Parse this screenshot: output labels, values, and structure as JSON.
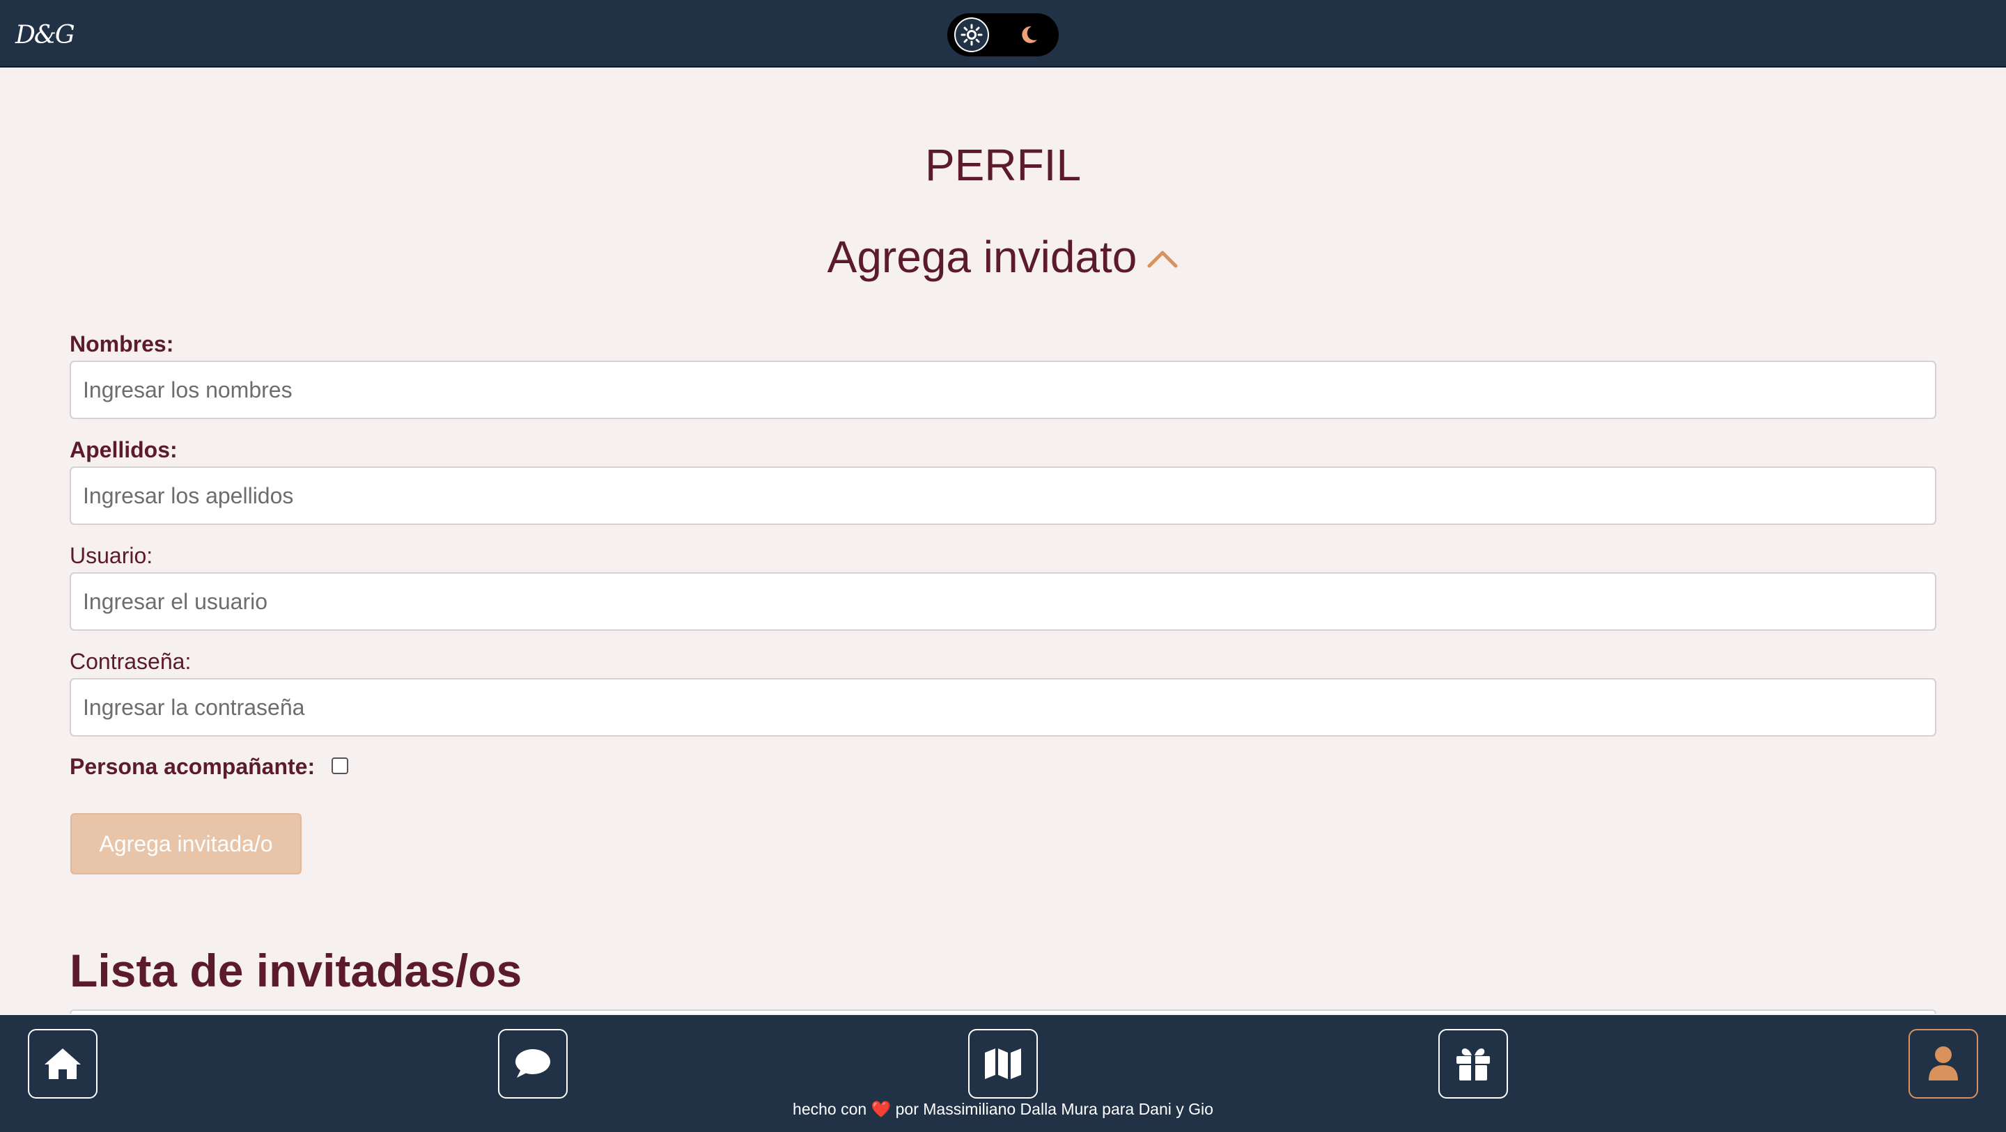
{
  "header": {
    "logo_text": "D&G",
    "theme_toggle": {
      "light_icon": "sun-icon",
      "dark_icon": "moon-icon",
      "selected": "light"
    }
  },
  "page": {
    "title": "PERFIL",
    "section_title": "Agrega invidato",
    "section_toggle_icon": "chevron-up-icon"
  },
  "form": {
    "nombres": {
      "label": "Nombres:",
      "placeholder": "Ingresar los nombres",
      "value": ""
    },
    "apellidos": {
      "label": "Apellidos:",
      "placeholder": "Ingresar los apellidos",
      "value": ""
    },
    "usuario": {
      "label": "Usuario:",
      "placeholder": "Ingresar el usuario",
      "value": ""
    },
    "contrasena": {
      "label": "Contraseña:",
      "placeholder": "Ingresar la contraseña",
      "value": ""
    },
    "companion": {
      "label": "Persona acompañante:",
      "checked": false
    },
    "submit_label": "Agrega invitada/o"
  },
  "guest_list": {
    "title": "Lista de invitadas/os"
  },
  "bottom_nav": {
    "items": [
      {
        "name": "home",
        "icon": "home-icon",
        "active": false
      },
      {
        "name": "chat",
        "icon": "chat-bubble-icon",
        "active": false
      },
      {
        "name": "map",
        "icon": "map-icon",
        "active": false
      },
      {
        "name": "gift",
        "icon": "gift-icon",
        "active": false
      },
      {
        "name": "profile",
        "icon": "user-icon",
        "active": true
      }
    ],
    "footer_prefix": "hecho con",
    "footer_heart": "❤️",
    "footer_suffix": "por Massimiliano Dalla Mura para Dani y Gio"
  },
  "colors": {
    "header_bg": "#213246",
    "page_bg": "#f7f0f0",
    "text_primary": "#5b1a2d",
    "accent": "#d9925c",
    "button_disabled_bg": "#e8c4a8"
  }
}
